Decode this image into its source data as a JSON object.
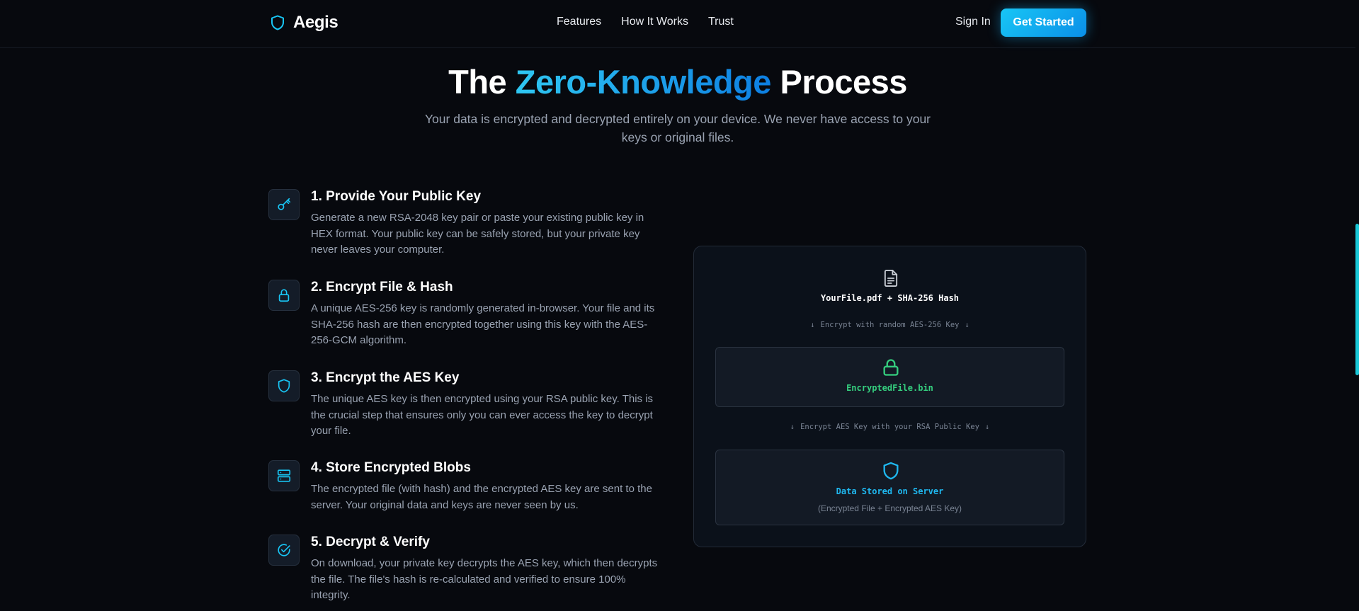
{
  "brand": {
    "name": "Aegis",
    "icon": "shield-icon",
    "accent": "#18c6f5"
  },
  "nav": {
    "items": [
      "Features",
      "How It Works",
      "Trust"
    ]
  },
  "auth": {
    "sign_in": "Sign In",
    "get_started": "Get Started"
  },
  "hero": {
    "title_prefix": "The ",
    "title_highlight": "Zero-Knowledge",
    "title_suffix": " Process",
    "subtitle": "Your data is encrypted and decrypted entirely on your device. We never have access to your keys or original files."
  },
  "steps": [
    {
      "icon": "key-icon",
      "title": "1. Provide Your Public Key",
      "description": "Generate a new RSA-2048 key pair or paste your existing public key in HEX format. Your public key can be safely stored, but your private key never leaves your computer."
    },
    {
      "icon": "lock-icon",
      "title": "2. Encrypt File & Hash",
      "description": "A unique AES-256 key is randomly generated in-browser. Your file and its SHA-256 hash are then encrypted together using this key with the AES-256-GCM algorithm."
    },
    {
      "icon": "shield-icon",
      "title": "3. Encrypt the AES Key",
      "description": "The unique AES key is then encrypted using your RSA public key. This is the crucial step that ensures only you can ever access the key to decrypt your file."
    },
    {
      "icon": "server-icon",
      "title": "4. Store Encrypted Blobs",
      "description": "The encrypted file (with hash) and the encrypted AES key are sent to the server. Your original data and keys are never seen by us."
    },
    {
      "icon": "check-circle-icon",
      "title": "5. Decrypt & Verify",
      "description": "On download, your private key decrypts the AES key, which then decrypts the file. The file's hash is re-calculated and verified to ensure 100% integrity."
    }
  ],
  "diagram": {
    "source_label": "YourFile.pdf + SHA-256 Hash",
    "arrow1_label": "Encrypt with random AES-256 Key",
    "encrypted_label": "EncryptedFile.bin",
    "arrow2_label": "Encrypt AES Key with your RSA Public Key",
    "stored_label": "Data Stored on Server",
    "stored_note": "(Encrypted File + Encrypted AES Key)",
    "colors": {
      "encrypted": "#35d07f",
      "stored": "#1fb8f0"
    }
  }
}
